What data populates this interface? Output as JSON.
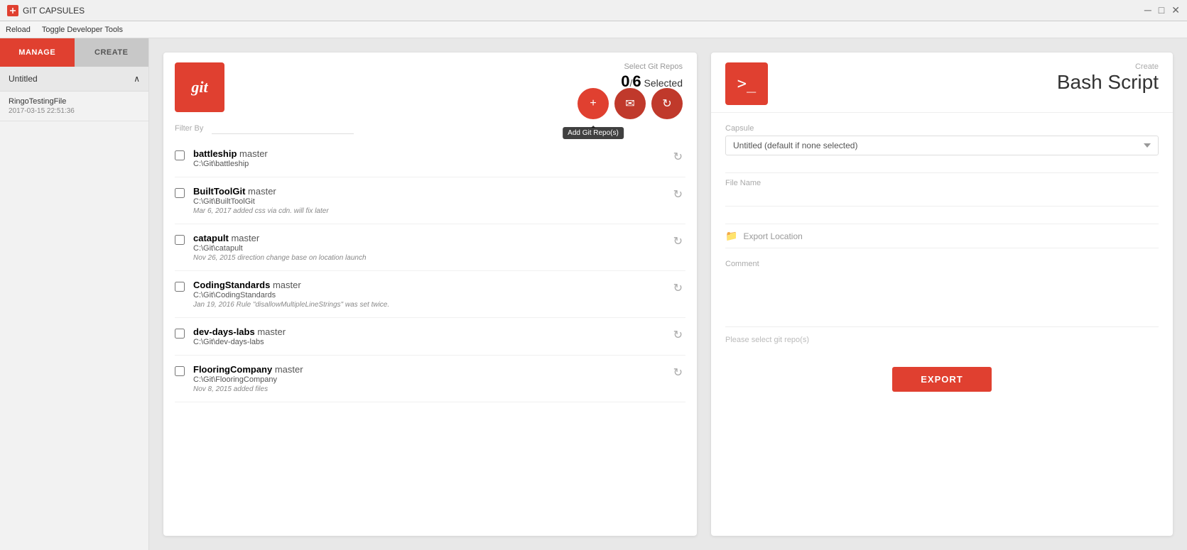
{
  "titleBar": {
    "appName": "GIT CAPSULES",
    "controls": {
      "minimize": "─",
      "maximize": "□",
      "close": "✕"
    }
  },
  "menuBar": {
    "items": [
      "Reload",
      "Toggle Developer Tools"
    ]
  },
  "sidebar": {
    "tabs": [
      {
        "id": "manage",
        "label": "MANAGE",
        "active": true
      },
      {
        "id": "create",
        "label": "CREATE",
        "active": false
      }
    ],
    "currentCapsule": {
      "name": "Untitled",
      "chevron": "∧"
    },
    "files": [
      {
        "name": "RingoTestingFile",
        "date": "2017-03-15 22:51:36"
      }
    ]
  },
  "gitPanel": {
    "logoText": "git",
    "header": {
      "selectGitReposLabel": "Select Git Repos",
      "selectedCount": "0",
      "totalCount": "6",
      "selectedLabel": "Selected"
    },
    "filterBy": {
      "label": "Filter By",
      "placeholder": ""
    },
    "actionButtons": [
      {
        "id": "add",
        "icon": "+",
        "tooltip": "Add Git Repo(s)",
        "ariaLabel": "Add Git Repo"
      },
      {
        "id": "email",
        "icon": "✉",
        "tooltip": "",
        "ariaLabel": "Email"
      },
      {
        "id": "refresh-all",
        "icon": "↻",
        "tooltip": "",
        "ariaLabel": "Refresh All"
      }
    ],
    "repos": [
      {
        "id": "battleship",
        "name": "battleship",
        "branch": "master",
        "path": "C:\\Git\\battleship",
        "commit": "",
        "checked": false
      },
      {
        "id": "BuiltToolGit",
        "name": "BuiltToolGit",
        "branch": "master",
        "path": "C:\\Git\\BuiltToolGit",
        "commit": "Mar 6, 2017 added css via cdn. will fix later",
        "checked": false
      },
      {
        "id": "catapult",
        "name": "catapult",
        "branch": "master",
        "path": "C:\\Git\\catapult",
        "commit": "Nov 26, 2015 direction change base on location launch",
        "checked": false
      },
      {
        "id": "CodingStandards",
        "name": "CodingStandards",
        "branch": "master",
        "path": "C:\\Git\\CodingStandards",
        "commit": "Jan 19, 2016 Rule \"disallowMultipleLineStrings\" was set twice.",
        "checked": false
      },
      {
        "id": "dev-days-labs",
        "name": "dev-days-labs",
        "branch": "master",
        "path": "C:\\Git\\dev-days-labs",
        "commit": "",
        "checked": false
      },
      {
        "id": "FlooringCompany",
        "name": "FlooringCompany",
        "branch": "master",
        "path": "C:\\Git\\FlooringCompany",
        "commit": "Nov 8, 2015 added files",
        "checked": false
      }
    ]
  },
  "createPanel": {
    "terminalIcon": ">_",
    "createLabel": "Create",
    "title": "Bash Script",
    "capsuleField": {
      "label": "Capsule",
      "placeholder": "Untitled (default if none selected)",
      "options": [
        "Untitled (default if none selected)"
      ]
    },
    "fileNameField": {
      "label": "File Name",
      "value": ""
    },
    "exportLocationField": {
      "label": "Export Location",
      "value": ""
    },
    "commentField": {
      "label": "Comment",
      "value": ""
    },
    "pleaseSelectMessage": "Please select git repo(s)",
    "exportButton": "EXPORT"
  }
}
